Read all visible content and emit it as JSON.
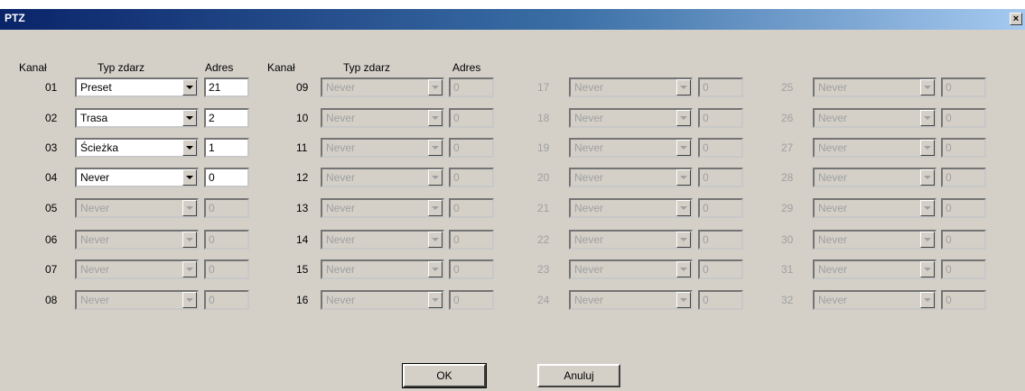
{
  "window": {
    "title": "PTZ",
    "close_glyph": "×"
  },
  "headers": {
    "channel": "Kanał",
    "event_type": "Typ zdarz",
    "address": "Adres"
  },
  "rows": [
    {
      "ch": "01",
      "type": "Preset",
      "addr": "21",
      "enabled": true
    },
    {
      "ch": "02",
      "type": "Trasa",
      "addr": "2",
      "enabled": true
    },
    {
      "ch": "03",
      "type": "Ścieżka",
      "addr": "1",
      "enabled": true
    },
    {
      "ch": "04",
      "type": "Never",
      "addr": "0",
      "enabled": true
    },
    {
      "ch": "05",
      "type": "Never",
      "addr": "0",
      "enabled": false
    },
    {
      "ch": "06",
      "type": "Never",
      "addr": "0",
      "enabled": false
    },
    {
      "ch": "07",
      "type": "Never",
      "addr": "0",
      "enabled": false
    },
    {
      "ch": "08",
      "type": "Never",
      "addr": "0",
      "enabled": false
    },
    {
      "ch": "09",
      "type": "Never",
      "addr": "0",
      "enabled": false
    },
    {
      "ch": "10",
      "type": "Never",
      "addr": "0",
      "enabled": false
    },
    {
      "ch": "11",
      "type": "Never",
      "addr": "0",
      "enabled": false
    },
    {
      "ch": "12",
      "type": "Never",
      "addr": "0",
      "enabled": false
    },
    {
      "ch": "13",
      "type": "Never",
      "addr": "0",
      "enabled": false
    },
    {
      "ch": "14",
      "type": "Never",
      "addr": "0",
      "enabled": false
    },
    {
      "ch": "15",
      "type": "Never",
      "addr": "0",
      "enabled": false
    },
    {
      "ch": "16",
      "type": "Never",
      "addr": "0",
      "enabled": false
    },
    {
      "ch": "17",
      "type": "Never",
      "addr": "0",
      "enabled": false
    },
    {
      "ch": "18",
      "type": "Never",
      "addr": "0",
      "enabled": false
    },
    {
      "ch": "19",
      "type": "Never",
      "addr": "0",
      "enabled": false
    },
    {
      "ch": "20",
      "type": "Never",
      "addr": "0",
      "enabled": false
    },
    {
      "ch": "21",
      "type": "Never",
      "addr": "0",
      "enabled": false
    },
    {
      "ch": "22",
      "type": "Never",
      "addr": "0",
      "enabled": false
    },
    {
      "ch": "23",
      "type": "Never",
      "addr": "0",
      "enabled": false
    },
    {
      "ch": "24",
      "type": "Never",
      "addr": "0",
      "enabled": false
    },
    {
      "ch": "25",
      "type": "Never",
      "addr": "0",
      "enabled": false
    },
    {
      "ch": "26",
      "type": "Never",
      "addr": "0",
      "enabled": false
    },
    {
      "ch": "27",
      "type": "Never",
      "addr": "0",
      "enabled": false
    },
    {
      "ch": "28",
      "type": "Never",
      "addr": "0",
      "enabled": false
    },
    {
      "ch": "29",
      "type": "Never",
      "addr": "0",
      "enabled": false
    },
    {
      "ch": "30",
      "type": "Never",
      "addr": "0",
      "enabled": false
    },
    {
      "ch": "31",
      "type": "Never",
      "addr": "0",
      "enabled": false
    },
    {
      "ch": "32",
      "type": "Never",
      "addr": "0",
      "enabled": false
    }
  ],
  "buttons": {
    "ok": "OK",
    "cancel": "Anuluj"
  }
}
